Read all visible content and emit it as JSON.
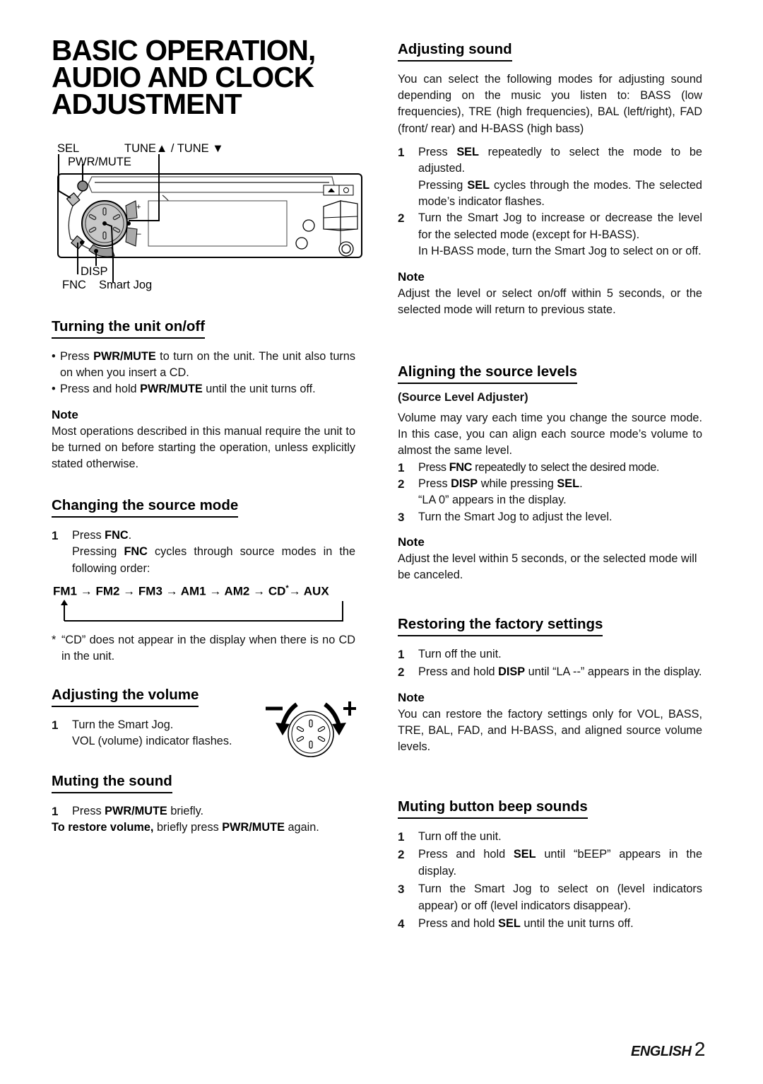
{
  "title": [
    "BASIC OPERATION,",
    "AUDIO AND CLOCK",
    "ADJUSTMENT"
  ],
  "diagram": {
    "labels": {
      "sel": "SEL",
      "tune": "TUNE▲ / TUNE ▼",
      "pwr_mute": "PWR/MUTE",
      "disp": "DISP",
      "fnc": "FNC",
      "smart_jog": "Smart Jog"
    }
  },
  "turning": {
    "heading": "Turning the unit on/off",
    "bullets": [
      {
        "pre": "Press ",
        "bold": "PWR/MUTE",
        "post": " to turn on the unit. The unit also turns on when you insert a CD."
      },
      {
        "pre": "Press and hold ",
        "bold": "PWR/MUTE",
        "post": " until the unit turns off."
      }
    ],
    "note_label": "Note",
    "note": "Most operations described in this manual require the unit to be turned on before starting the operation, unless explicitly stated otherwise."
  },
  "source_mode": {
    "heading": "Changing the source mode",
    "step1_pre": "Press ",
    "step1_bold": "FNC",
    "step1_post": ".",
    "step1_detail_pre": "Pressing ",
    "step1_detail_bold": "FNC",
    "step1_detail_post": " cycles through source modes in the following order:",
    "flow": [
      "FM1",
      "FM2",
      "FM3",
      "AM1",
      "AM2",
      "CD",
      "AUX"
    ],
    "flow_asterisk": "*",
    "footnote_mark": "*",
    "footnote": "“CD” does not appear in the display when there is no CD in the unit."
  },
  "volume": {
    "heading": "Adjusting the volume",
    "step1": "Turn the Smart Jog.",
    "step1_detail": "VOL (volume) indicator flashes.",
    "minus": "−",
    "plus": "+"
  },
  "muting": {
    "heading": "Muting the sound",
    "step1_pre": "Press ",
    "step1_bold": "PWR/MUTE",
    "step1_post": " briefly.",
    "restore_bold": "To restore volume,",
    "restore_mid": " briefly press ",
    "restore_bold2": "PWR/MUTE",
    "restore_post": " again."
  },
  "adjusting_sound": {
    "heading": "Adjusting sound",
    "intro": "You can select the following modes for adjusting sound depending on the music you listen to: BASS (low frequencies), TRE (high frequencies), BAL (left/right), FAD (front/ rear) and H-BASS (high bass)",
    "step1_pre": "Press ",
    "step1_bold": "SEL",
    "step1_post": " repeatedly to select the mode to be adjusted.",
    "step1_detail_pre": "Pressing ",
    "step1_detail_bold": "SEL",
    "step1_detail_post": " cycles through the modes. The selected mode’s indicator flashes.",
    "step2": "Turn the Smart Jog to increase or decrease the level for the selected mode (except for H-BASS).",
    "step2_detail": "In H-BASS mode, turn the Smart Jog to select on or off.",
    "note_label": "Note",
    "note": "Adjust the level or select on/off within 5 seconds, or the selected mode will return to previous state."
  },
  "aligning": {
    "heading": "Aligning the source levels",
    "subheading": "(Source Level Adjuster)",
    "intro": "Volume may vary each time you change the source mode. In this case, you can align each source mode’s volume to almost the same level.",
    "step1_pre": "Press ",
    "step1_bold": "FNC",
    "step1_post": " repeatedly to select the desired mode.",
    "step2_pre": "Press ",
    "step2_bold": "DISP",
    "step2_mid": " while pressing ",
    "step2_bold2": "SEL",
    "step2_post": ".",
    "step2_detail": "“LA 0” appears in the display.",
    "step3": "Turn the Smart Jog to adjust the level.",
    "note_label": "Note",
    "note": "Adjust the level within 5 seconds, or the selected mode will be canceled."
  },
  "restoring": {
    "heading": "Restoring the factory settings",
    "step1": "Turn off the unit.",
    "step2_pre": "Press and hold ",
    "step2_bold": "DISP",
    "step2_post": " until “LA --” appears in the display.",
    "note_label": "Note",
    "note": "You can restore the factory settings only for VOL, BASS, TRE, BAL, FAD, and H-BASS, and aligned source volume levels."
  },
  "beep": {
    "heading": "Muting button beep sounds",
    "step1": "Turn off the unit.",
    "step2_pre": "Press and hold ",
    "step2_bold": "SEL",
    "step2_post": " until “bEEP” appears in the display.",
    "step3": "Turn the Smart Jog to select on (level indicators appear) or off (level indicators disappear).",
    "step4_pre": "Press and hold ",
    "step4_bold": "SEL",
    "step4_post": " until the unit turns off."
  },
  "numbers": [
    "1",
    "2",
    "3",
    "4"
  ],
  "footer": {
    "language": "ENGLISH",
    "page": "2"
  }
}
